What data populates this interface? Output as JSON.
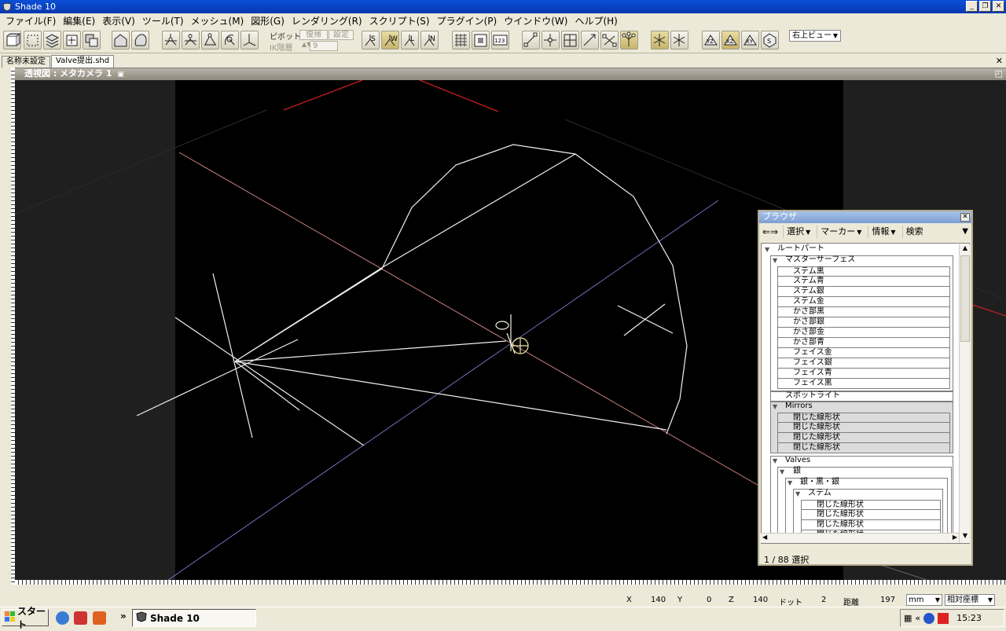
{
  "app": {
    "title": "Shade 10"
  },
  "menu": [
    "ファイル(F)",
    "編集(E)",
    "表示(V)",
    "ツール(T)",
    "メッシュ(M)",
    "図形(G)",
    "レンダリング(R)",
    "スクリプト(S)",
    "プラグイン(P)",
    "ウインドウ(W)",
    "ヘルプ(H)"
  ],
  "toolbar": {
    "pivot_label": "ピボット",
    "ik_label": "IK階層",
    "restore_label": "復帰",
    "settings_label": "設定",
    "ik_value": "9",
    "view_select": "右上ビュー",
    "view_buttons": [
      "YZ",
      "XZ",
      "XY"
    ]
  },
  "tabs": [
    "名称未設定",
    "Valve提出.shd"
  ],
  "viewport": {
    "title": "透視図 : メタカメラ 1"
  },
  "browser": {
    "title": "ブラウザ",
    "menus": [
      "選択",
      "マーカー",
      "情報",
      "検索"
    ],
    "tree": {
      "root": "ルートパート",
      "master_surface": "マスターサーフェス",
      "surfaces": [
        "ステム黒",
        "ステム青",
        "ステム銀",
        "ステム金",
        "かさ部黒",
        "かさ部銀",
        "かさ部金",
        "かさ部青",
        "フェイス金",
        "フェイス銀",
        "フェイス青",
        "フェイス黒"
      ],
      "spotlight": "スポットライト",
      "mirrors": "Mirrors",
      "mirror_items": [
        "閉じた線形状",
        "閉じた線形状",
        "閉じた線形状",
        "閉じた線形状"
      ],
      "valves": "Valves",
      "silver": "銀",
      "silver_group": "銀・黒・銀",
      "stem": "ステム",
      "stem_items": [
        "閉じた線形状",
        "閉じた線形状",
        "閉じた線形状",
        "閉じた線形状"
      ]
    },
    "status": "1 / 88 選択"
  },
  "statusbar": {
    "x_label": "X",
    "x_value": "140",
    "y_label": "Y",
    "y_value": "0",
    "z_label": "Z",
    "z_value": "140",
    "dot_label": "ドット",
    "dot_value": "2",
    "dist_label": "距離",
    "dist_value": "197",
    "unit": "mm",
    "coord_mode": "相対座標"
  },
  "taskbar": {
    "start_label": "スタート",
    "task_label": "Shade 10",
    "clock": "15:23",
    "chevron": "«"
  }
}
